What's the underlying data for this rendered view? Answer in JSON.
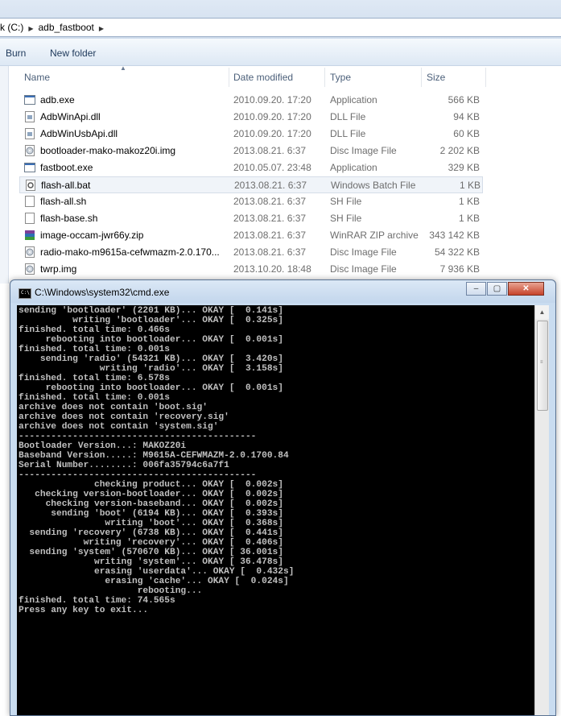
{
  "explorer": {
    "breadcrumbs": [
      "k (C:)",
      "adb_fastboot"
    ],
    "toolbar": {
      "burn": "Burn",
      "new_folder": "New folder"
    },
    "columns": {
      "name": "Name",
      "date": "Date modified",
      "type": "Type",
      "size": "Size"
    },
    "files": [
      {
        "name": "adb.exe",
        "date": "2010.09.20. 17:20",
        "type": "Application",
        "size": "566 KB",
        "icon": "exe-icon"
      },
      {
        "name": "AdbWinApi.dll",
        "date": "2010.09.20. 17:20",
        "type": "DLL File",
        "size": "94 KB",
        "icon": "dll-icon"
      },
      {
        "name": "AdbWinUsbApi.dll",
        "date": "2010.09.20. 17:20",
        "type": "DLL File",
        "size": "60 KB",
        "icon": "dll-icon"
      },
      {
        "name": "bootloader-mako-makoz20i.img",
        "date": "2013.08.21. 6:37",
        "type": "Disc Image File",
        "size": "2 202 KB",
        "icon": "disc-image-icon"
      },
      {
        "name": "fastboot.exe",
        "date": "2010.05.07. 23:48",
        "type": "Application",
        "size": "329 KB",
        "icon": "exe-icon"
      },
      {
        "name": "flash-all.bat",
        "date": "2013.08.21. 6:37",
        "type": "Windows Batch File",
        "size": "1 KB",
        "icon": "batch-file-icon",
        "selected": true
      },
      {
        "name": "flash-all.sh",
        "date": "2013.08.21. 6:37",
        "type": "SH File",
        "size": "1 KB",
        "icon": "text-file-icon"
      },
      {
        "name": "flash-base.sh",
        "date": "2013.08.21. 6:37",
        "type": "SH File",
        "size": "1 KB",
        "icon": "text-file-icon"
      },
      {
        "name": "image-occam-jwr66y.zip",
        "date": "2013.08.21. 6:37",
        "type": "WinRAR ZIP archive",
        "size": "343 142 KB",
        "icon": "winrar-zip-icon"
      },
      {
        "name": "radio-mako-m9615a-cefwmazm-2.0.170...",
        "date": "2013.08.21. 6:37",
        "type": "Disc Image File",
        "size": "54 322 KB",
        "icon": "disc-image-icon"
      },
      {
        "name": "twrp.img",
        "date": "2013.10.20. 18:48",
        "type": "Disc Image File",
        "size": "7 936 KB",
        "icon": "disc-image-icon"
      }
    ]
  },
  "cmd": {
    "title": "C:\\Windows\\system32\\cmd.exe",
    "lines": [
      "sending 'bootloader' (2201 KB)... OKAY [  0.141s]",
      "          writing 'bootloader'... OKAY [  0.325s]",
      "finished. total time: 0.466s",
      "     rebooting into bootloader... OKAY [  0.001s]",
      "finished. total time: 0.001s",
      "    sending 'radio' (54321 KB)... OKAY [  3.420s]",
      "               writing 'radio'... OKAY [  3.158s]",
      "finished. total time: 6.578s",
      "     rebooting into bootloader... OKAY [  0.001s]",
      "finished. total time: 0.001s",
      "archive does not contain 'boot.sig'",
      "archive does not contain 'recovery.sig'",
      "archive does not contain 'system.sig'",
      "--------------------------------------------",
      "Bootloader Version...: MAKOZ20i",
      "Baseband Version.....: M9615A-CEFWMAZM-2.0.1700.84",
      "Serial Number........: 006fa35794c6a7f1",
      "--------------------------------------------",
      "              checking product... OKAY [  0.002s]",
      "   checking version-bootloader... OKAY [  0.002s]",
      "     checking version-baseband... OKAY [  0.002s]",
      "      sending 'boot' (6194 KB)... OKAY [  0.393s]",
      "                writing 'boot'... OKAY [  0.368s]",
      "  sending 'recovery' (6738 KB)... OKAY [  0.441s]",
      "            writing 'recovery'... OKAY [  0.406s]",
      "  sending 'system' (570670 KB)... OKAY [ 36.001s]",
      "              writing 'system'... OKAY [ 36.478s]",
      "              erasing 'userdata'... OKAY [  0.432s]",
      "                erasing 'cache'... OKAY [  0.024s]",
      "                      rebooting...",
      "finished. total time: 74.565s",
      "Press any key to exit..."
    ],
    "buttons": {
      "minimize": "‒",
      "maximize": "▢",
      "close": "✕"
    }
  }
}
